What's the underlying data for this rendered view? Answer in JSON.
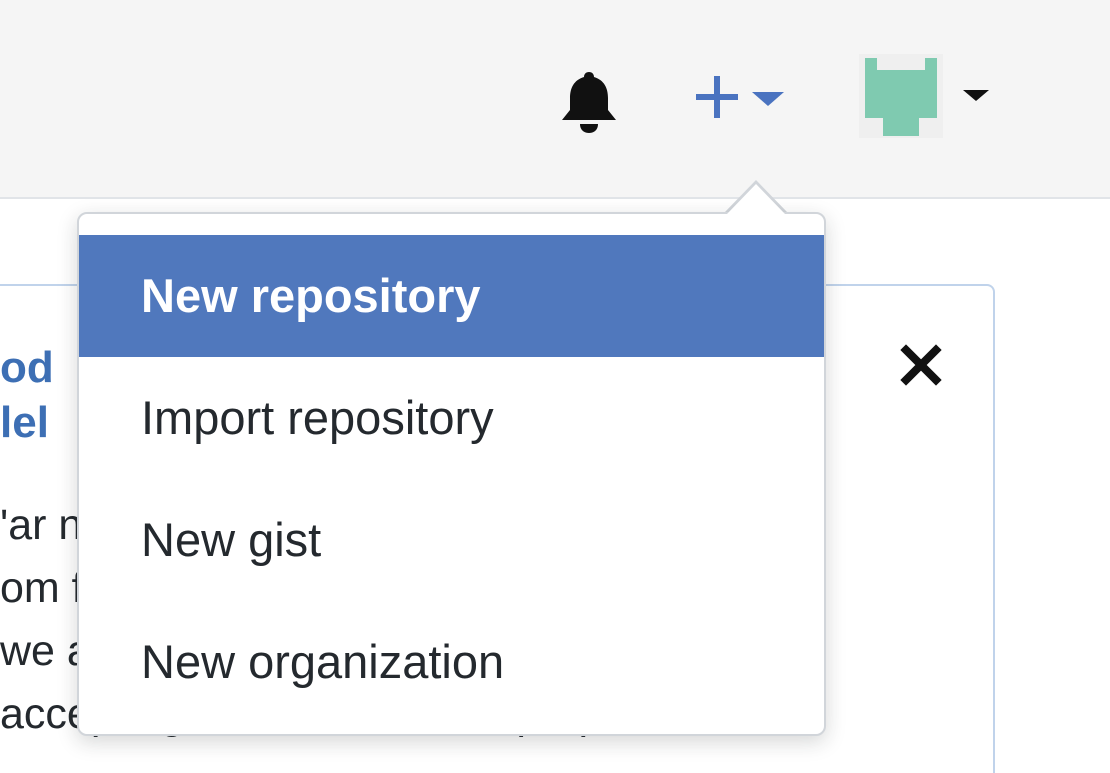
{
  "header": {
    "icons": {
      "bell": "bell-icon",
      "plus": "plus-icon",
      "caret": "caret-down-icon",
      "avatar": "avatar"
    }
  },
  "notice": {
    "title": "od\nlel",
    "body_lines": [
      "'ar                                                         n",
      "om                                                       feel",
      "we                                                      are",
      "accepting feedback on our proposed"
    ],
    "close_label": "×"
  },
  "dropdown": {
    "items": [
      {
        "label": "New repository",
        "active": true
      },
      {
        "label": "Import repository",
        "active": false
      },
      {
        "label": "New gist",
        "active": false
      },
      {
        "label": "New organization",
        "active": false
      }
    ]
  },
  "colors": {
    "accent": "#5078bd",
    "link": "#3d6fb4",
    "header_bg": "#f5f5f5",
    "avatar": "#7fcab0",
    "text": "#24292e"
  }
}
